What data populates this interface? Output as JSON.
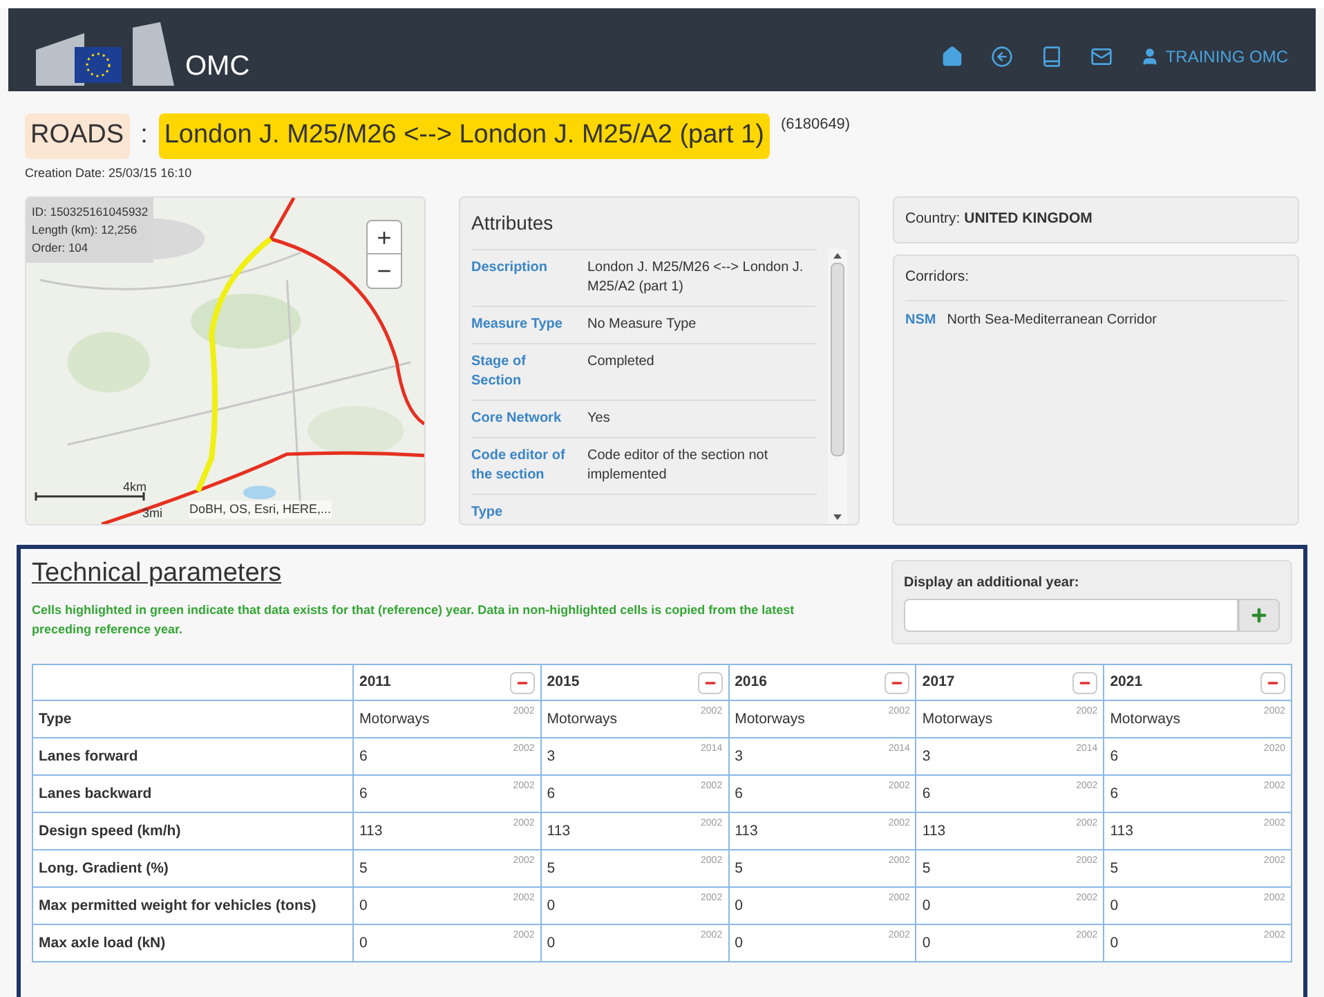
{
  "header": {
    "app_name": "OMC",
    "user": "TRAINING OMC"
  },
  "title": {
    "category": "ROADS",
    "separator": ":",
    "name": "London J. M25/M26 <--> London J. M25/A2 (part 1)",
    "code": "(6180649)",
    "creation_date": "Creation Date: 25/03/15 16:10"
  },
  "map": {
    "info": [
      "ID: 150325161045932",
      "Length (km): 12,256",
      "Order: 104"
    ],
    "zoom_in": "+",
    "zoom_out": "−",
    "scale_km": "4km",
    "scale_mi": "3mi",
    "attribution": "DoBH, OS, Esri, HERE,..."
  },
  "attributes": {
    "title": "Attributes",
    "rows": [
      {
        "label": "Description",
        "value": "London J. M25/M26 <--> London J. M25/A2 (part 1)"
      },
      {
        "label": "Measure Type",
        "value": "No Measure Type"
      },
      {
        "label": "Stage of Section",
        "value": "Completed"
      },
      {
        "label": "Core Network",
        "value": "Yes"
      },
      {
        "label": "Code editor of the section",
        "value": "Code editor of the section not implemented"
      },
      {
        "label": "Type",
        "value": ""
      }
    ]
  },
  "country": {
    "label": "Country:",
    "value": "UNITED KINGDOM"
  },
  "corridors": {
    "title": "Corridors:",
    "items": [
      {
        "code": "NSM",
        "name": "North Sea-Mediterranean Corridor"
      }
    ]
  },
  "technical": {
    "title": "Technical parameters",
    "note": "Cells highlighted in green indicate that data exists for that (reference) year. Data in non-highlighted cells is copied from the latest preceding reference year.",
    "add_year_label": "Display an additional year:",
    "years": [
      "2011",
      "2015",
      "2016",
      "2017",
      "2021"
    ],
    "rows": [
      {
        "label": "Type",
        "cells": [
          [
            "Motorways",
            "2002"
          ],
          [
            "Motorways",
            "2002"
          ],
          [
            "Motorways",
            "2002"
          ],
          [
            "Motorways",
            "2002"
          ],
          [
            "Motorways",
            "2002"
          ]
        ]
      },
      {
        "label": "Lanes forward",
        "cells": [
          [
            "6",
            "2002"
          ],
          [
            "3",
            "2014"
          ],
          [
            "3",
            "2014"
          ],
          [
            "3",
            "2014"
          ],
          [
            "6",
            "2020"
          ]
        ]
      },
      {
        "label": "Lanes backward",
        "cells": [
          [
            "6",
            "2002"
          ],
          [
            "6",
            "2002"
          ],
          [
            "6",
            "2002"
          ],
          [
            "6",
            "2002"
          ],
          [
            "6",
            "2002"
          ]
        ]
      },
      {
        "label": "Design speed (km/h)",
        "cells": [
          [
            "113",
            "2002"
          ],
          [
            "113",
            "2002"
          ],
          [
            "113",
            "2002"
          ],
          [
            "113",
            "2002"
          ],
          [
            "113",
            "2002"
          ]
        ]
      },
      {
        "label": "Long. Gradient (%)",
        "cells": [
          [
            "5",
            "2002"
          ],
          [
            "5",
            "2002"
          ],
          [
            "5",
            "2002"
          ],
          [
            "5",
            "2002"
          ],
          [
            "5",
            "2002"
          ]
        ]
      },
      {
        "label": "Max permitted weight for vehicles (tons)",
        "cells": [
          [
            "0",
            "2002"
          ],
          [
            "0",
            "2002"
          ],
          [
            "0",
            "2002"
          ],
          [
            "0",
            "2002"
          ],
          [
            "0",
            "2002"
          ]
        ]
      },
      {
        "label": "Max axle load (kN)",
        "cells": [
          [
            "0",
            "2002"
          ],
          [
            "0",
            "2002"
          ],
          [
            "0",
            "2002"
          ],
          [
            "0",
            "2002"
          ],
          [
            "0",
            "2002"
          ]
        ]
      }
    ]
  }
}
